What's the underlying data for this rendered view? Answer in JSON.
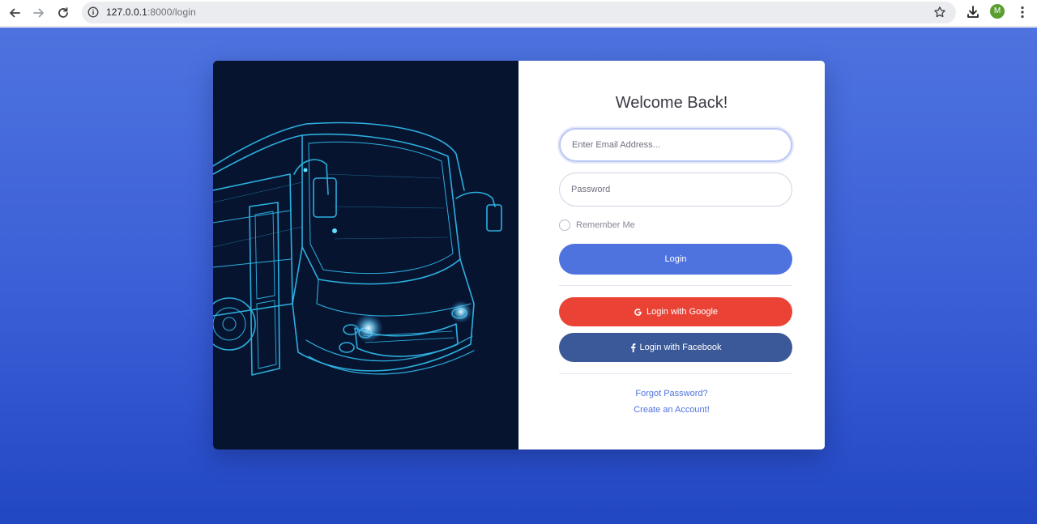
{
  "browser": {
    "url_host": "127.0.0.1",
    "url_rest": ":8000/login",
    "profile_initial": "M",
    "icons": [
      "back-icon",
      "forward-icon",
      "reload-icon",
      "info-icon",
      "star-icon",
      "download-icon",
      "menu-icon"
    ]
  },
  "login": {
    "title": "Welcome Back!",
    "email_placeholder": "Enter Email Address...",
    "password_placeholder": "Password",
    "remember_label": "Remember Me",
    "login_button": "Login",
    "google_button": "Login with Google",
    "facebook_button": "Login with Facebook",
    "forgot_link": "Forgot Password?",
    "create_link": "Create an Account!"
  },
  "colors": {
    "primary": "#4e73df",
    "google": "#ea4335",
    "facebook": "#3b5998",
    "image_bg": "#071430"
  }
}
